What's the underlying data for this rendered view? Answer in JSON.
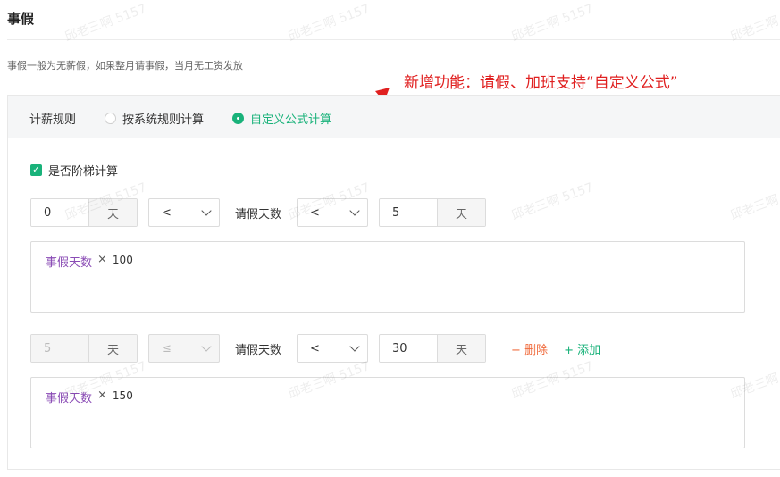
{
  "page": {
    "title": "事假",
    "subtitle": "事假一般为无薪假，如果整月请事假，当月无工资发放"
  },
  "annotation": {
    "text": "新增功能：请假、加班支持“自定义公式”",
    "color": "#e02020"
  },
  "salary_rule": {
    "label": "计薪规则",
    "options": [
      {
        "label": "按系统规则计算",
        "selected": false
      },
      {
        "label": "自定义公式计算",
        "selected": true
      }
    ]
  },
  "tiered": {
    "label": "是否阶梯计算",
    "checked": true
  },
  "tiers": [
    {
      "from_value": "0",
      "from_unit": "天",
      "op1": "<",
      "variable_label": "请假天数",
      "op2": "<",
      "to_value": "5",
      "to_unit": "天",
      "formula": {
        "variable": "事假天数",
        "operator": "×",
        "value": "100"
      }
    },
    {
      "from_value": "5",
      "from_unit": "天",
      "op1": "≤",
      "variable_label": "请假天数",
      "op2": "<",
      "to_value": "30",
      "to_unit": "天",
      "delete_label": "删除",
      "add_label": "添加",
      "formula": {
        "variable": "事假天数",
        "operator": "×",
        "value": "150"
      }
    }
  ],
  "watermark": {
    "text": "邱老三啊 5157"
  },
  "colors": {
    "accent": "#19b27a",
    "danger": "#f06a3b",
    "formula_var": "#8a4bb5"
  }
}
